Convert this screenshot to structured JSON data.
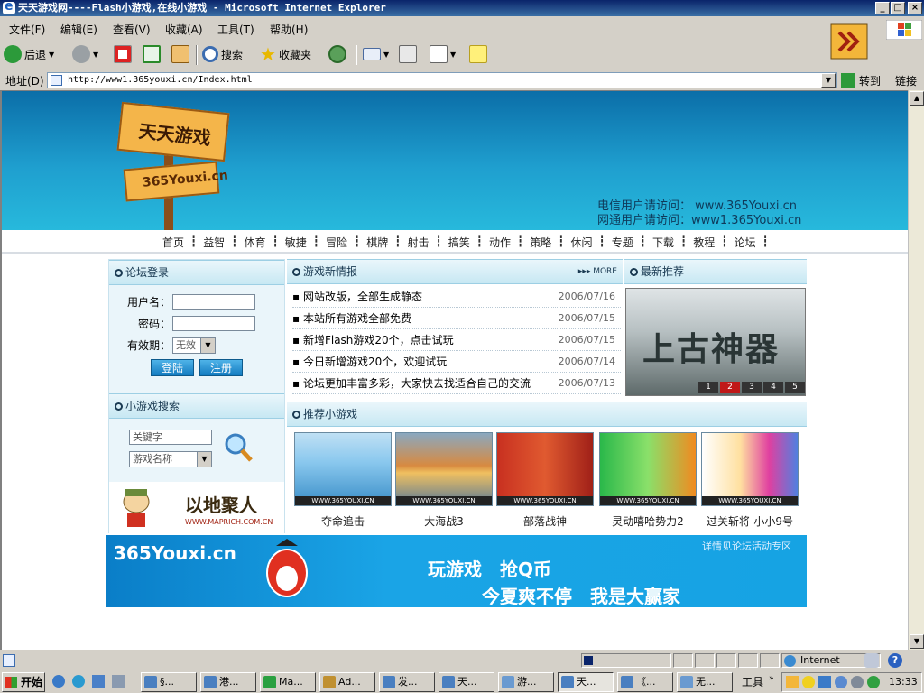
{
  "window": {
    "title": "天天游戏网----Flash小游戏,在线小游戏 - Microsoft Internet Explorer",
    "controls": {
      "minimize": "_",
      "maximize": "□",
      "close": "×"
    }
  },
  "menubar": [
    "文件(F)",
    "编辑(E)",
    "查看(V)",
    "收藏(A)",
    "工具(T)",
    "帮助(H)"
  ],
  "toolbar": {
    "back": "后退",
    "search": "搜索",
    "favorites": "收藏夹"
  },
  "address": {
    "label": "地址(D)",
    "url": "http://www1.365youxi.cn/Index.html",
    "go": "转到",
    "links": "链接"
  },
  "page": {
    "logo_top": "天天游戏",
    "logo_bottom": "365Youxi.cn",
    "visit1": "电信用户请访问： www.365Youxi.cn",
    "visit2": "网通用户请访问：www1.365Youxi.cn",
    "nav": [
      "首页",
      "益智",
      "体育",
      "敏捷",
      "冒险",
      "棋牌",
      "射击",
      "搞笑",
      "动作",
      "策略",
      "休闲",
      "专题",
      "下载",
      "教程",
      "论坛"
    ],
    "nav_sep": "┇",
    "login": {
      "title": "论坛登录",
      "username_label": "用户名：",
      "password_label": "密码：",
      "expiry_label": "有效期：",
      "expiry_value": "无效",
      "login_button": "登陆",
      "register_button": "注册"
    },
    "search": {
      "title": "小游戏搜索",
      "keyword_placeholder": "关键字",
      "type_value": "游戏名称"
    },
    "ad_left": {
      "text": "以地聚人",
      "url": "WWW.MAPRICH.COM.CN"
    },
    "news": {
      "title": "游戏新情报",
      "more": "MORE",
      "items": [
        {
          "title": "网站改版，全部生成静态",
          "date": "2006/07/16"
        },
        {
          "title": "本站所有游戏全部免费",
          "date": "2006/07/15"
        },
        {
          "title": "新增Flash游戏20个，点击试玩",
          "date": "2006/07/15"
        },
        {
          "title": "今日新增游戏20个，欢迎试玩",
          "date": "2006/07/14"
        },
        {
          "title": "论坛更加丰富多彩，大家快去找适合自己的交流",
          "date": "2006/07/13"
        }
      ]
    },
    "recommend": {
      "title": "最新推荐",
      "image_text": "上古神器",
      "pages": [
        "1",
        "2",
        "3",
        "4",
        "5"
      ],
      "active_page": 2
    },
    "games": {
      "title": "推荐小游戏",
      "watermark": "WWW.365YOUXI.CN",
      "items": [
        {
          "name": "夺命追击"
        },
        {
          "name": "大海战3"
        },
        {
          "name": "部落战神"
        },
        {
          "name": "灵动嘻哈势力2"
        },
        {
          "name": "过关斩将-小小9号"
        }
      ]
    },
    "banner": {
      "logo": "365Youxi.cn",
      "line1": "玩游戏　抢Q币",
      "line2": "今夏爽不停　我是大赢家",
      "note": "详情见论坛活动专区"
    }
  },
  "statusbar": {
    "zone": "Internet"
  },
  "taskbar": {
    "start": "开始",
    "tasks": [
      "§...",
      "港...",
      "Ma...",
      "Ad...",
      "发...",
      "天...",
      "游...",
      "天...",
      "《...",
      "无..."
    ],
    "active_task": 7,
    "tools": "工具",
    "clock": "13:33"
  },
  "colors": {
    "accent": "#1f9fcf",
    "title_bar": "#0a246a"
  }
}
